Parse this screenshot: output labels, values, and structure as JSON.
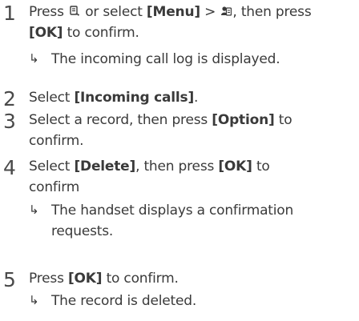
{
  "steps": [
    {
      "number": "1",
      "line1_a": "Press",
      "line1_b": "or select",
      "line1_menu": "[Menu]",
      "line1_gt": ">",
      "line1_c": ", then press",
      "line2_ok": "[OK]",
      "line2_rest": "to confirm.",
      "result": "The incoming call log is displayed."
    },
    {
      "number": "2",
      "text_a": "Select",
      "text_b": "[Incoming calls]",
      "text_c": "."
    },
    {
      "number": "3",
      "line1_a": "Select a record, then press",
      "line1_b": "[Option]",
      "line1_c": "to",
      "line2": "confirm."
    },
    {
      "number": "4",
      "line1_a": "Select",
      "line1_b": "[Delete]",
      "line1_c": ", then press",
      "line1_d": "[OK]",
      "line1_e": "to",
      "line2": "confirm",
      "result_line1": "The handset displays a confirmation",
      "result_line2": "requests."
    },
    {
      "number": "5",
      "text_a": "Press",
      "text_b": "[OK]",
      "text_c": "to confirm.",
      "result": "The record is deleted."
    }
  ],
  "arrow": "↳",
  "icons": {
    "call_log_key": "call-log-key-icon",
    "phonebook": "phonebook-icon"
  }
}
